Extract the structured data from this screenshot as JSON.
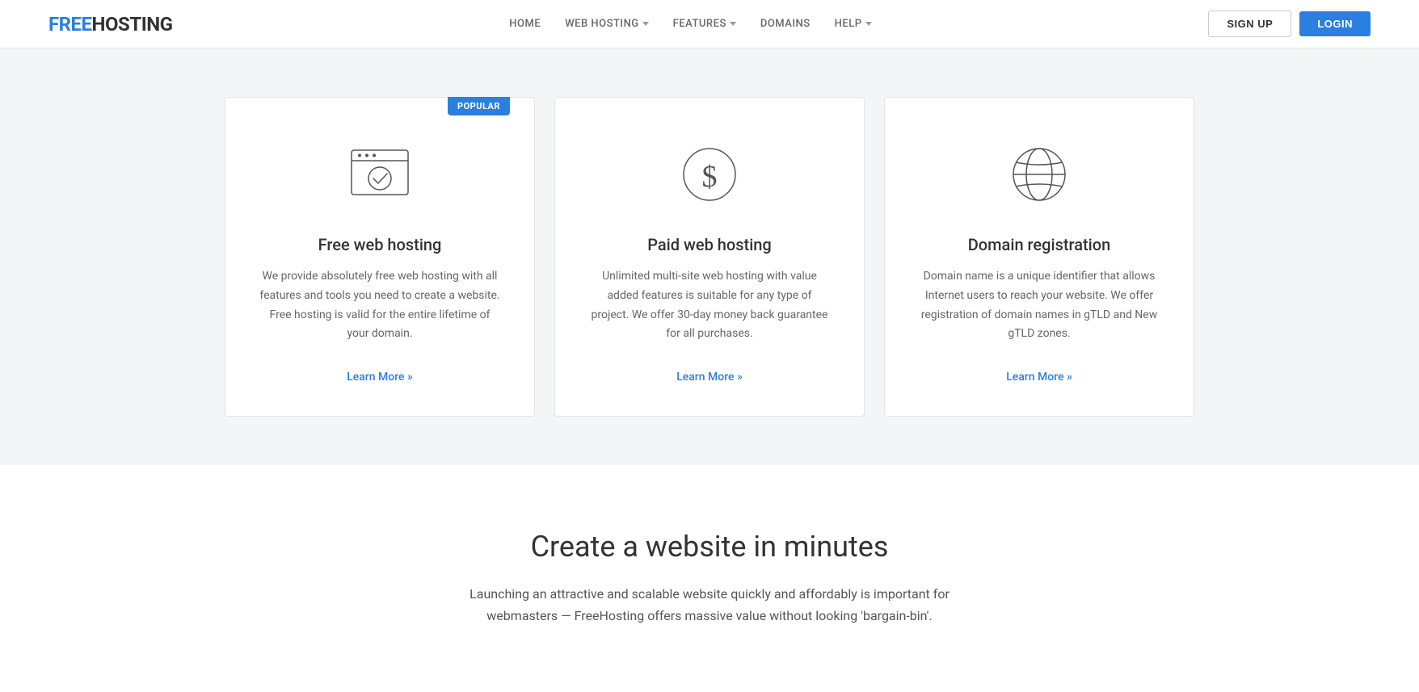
{
  "header": {
    "logo_free": "FREE",
    "logo_hosting": "HOSTING",
    "nav": {
      "home": "HOME",
      "web_hosting": "WEB HOSTING",
      "features": "FEATURES",
      "domains": "DOMAINS",
      "help": "HELP"
    },
    "signup_label": "SIGN UP",
    "login_label": "LOGIN"
  },
  "cards": [
    {
      "id": "free-hosting",
      "title": "Free web hosting",
      "description": "We provide absolutely free web hosting with all features and tools you need to create a website. Free hosting is valid for the entire lifetime of your domain.",
      "learn_more": "Learn More »",
      "popular": true,
      "popular_label": "POPULAR",
      "icon": "browser-check"
    },
    {
      "id": "paid-hosting",
      "title": "Paid web hosting",
      "description": "Unlimited multi-site web hosting with value added features is suitable for any type of project. We offer 30-day money back guarantee for all purchases.",
      "learn_more": "Learn More »",
      "popular": false,
      "icon": "dollar"
    },
    {
      "id": "domain-registration",
      "title": "Domain registration",
      "description": "Domain name is a unique identifier that allows Internet users to reach your website. We offer registration of domain names in gTLD and New gTLD zones.",
      "learn_more": "Learn More »",
      "popular": false,
      "icon": "globe"
    }
  ],
  "bottom": {
    "title": "Create a website in minutes",
    "description": "Launching an attractive and scalable website quickly and affordably is important for webmasters — FreeHosting offers massive value without looking 'bargain-bin'."
  }
}
